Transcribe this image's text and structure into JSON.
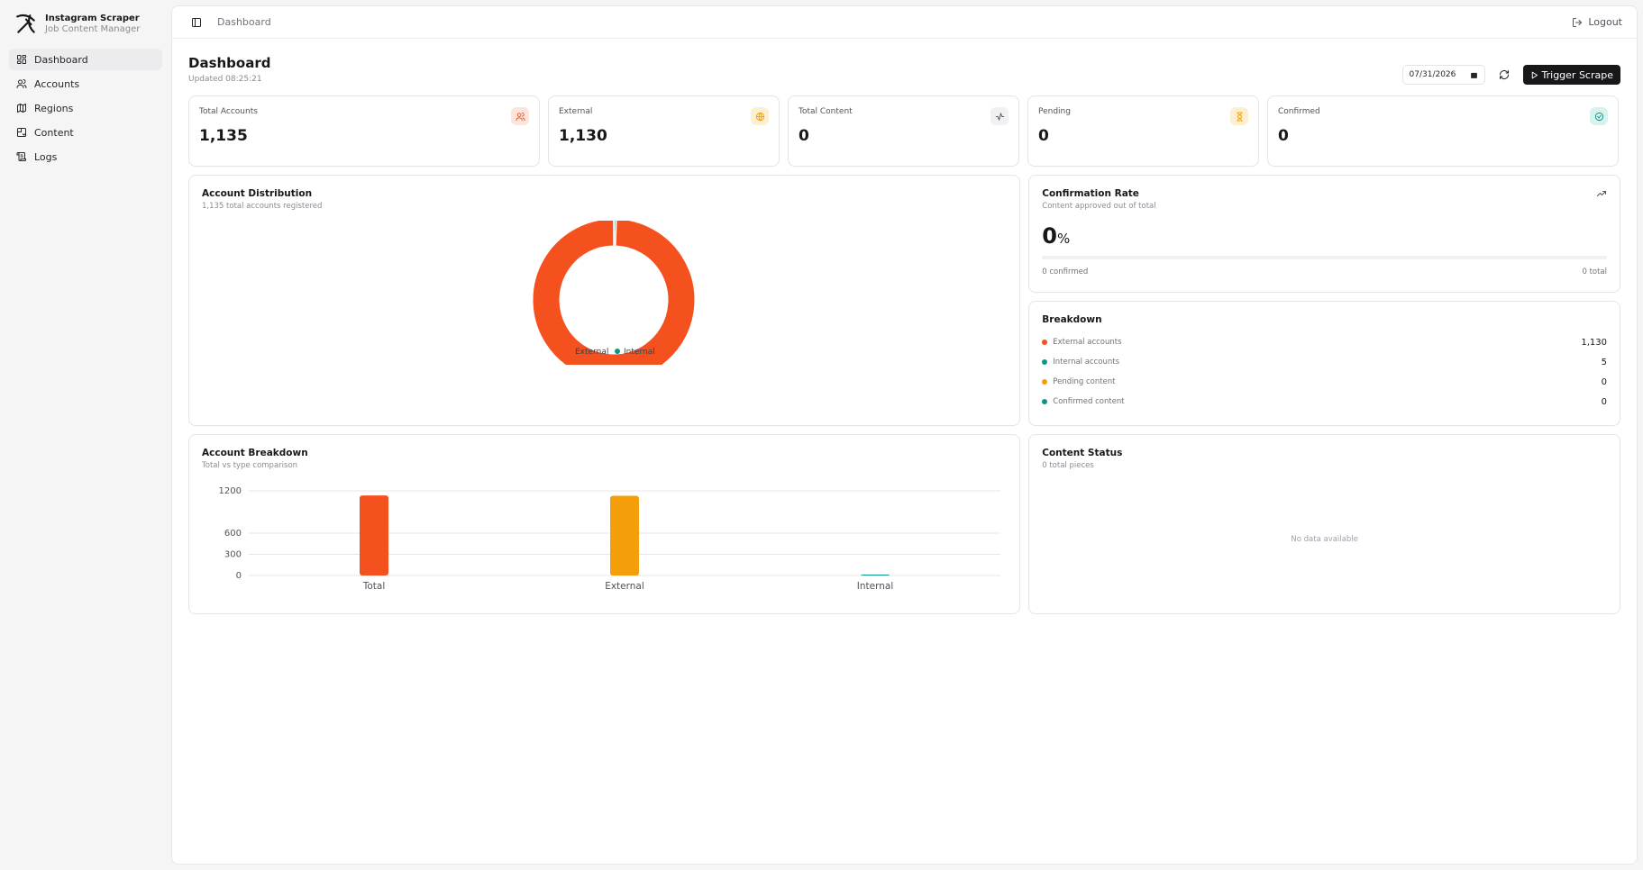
{
  "brand": {
    "title": "Instagram Scraper",
    "subtitle": "Job Content Manager"
  },
  "sidebar": {
    "items": [
      {
        "label": "Dashboard",
        "icon": "grid-icon",
        "active": true
      },
      {
        "label": "Accounts",
        "icon": "users-icon"
      },
      {
        "label": "Regions",
        "icon": "map-icon"
      },
      {
        "label": "Content",
        "icon": "content-icon"
      },
      {
        "label": "Logs",
        "icon": "scroll-icon"
      }
    ]
  },
  "topbar": {
    "breadcrumb": "Dashboard",
    "logout_label": "Logout"
  },
  "header": {
    "title": "Dashboard",
    "updated": "Updated 08:25:21",
    "date_value": "07/31/2026",
    "trigger_label": "Trigger Scrape"
  },
  "stats": [
    {
      "label": "Total Accounts",
      "value": "1,135",
      "icon": "users-icon",
      "badge_bg": "#fde4dc",
      "icon_color": "#f4511e"
    },
    {
      "label": "External",
      "value": "1,130",
      "icon": "globe-icon",
      "badge_bg": "#fdf0d0",
      "icon_color": "#f59e0b"
    },
    {
      "label": "Total Content",
      "value": "0",
      "icon": "activity-icon",
      "badge_bg": "#f1f1f3",
      "icon_color": "#52525b"
    },
    {
      "label": "Pending",
      "value": "0",
      "icon": "hourglass-icon",
      "badge_bg": "#fdf0d0",
      "icon_color": "#f59e0b"
    },
    {
      "label": "Confirmed",
      "value": "0",
      "icon": "check-circle-icon",
      "badge_bg": "#d8f2ee",
      "icon_color": "#0d9488"
    }
  ],
  "distribution": {
    "title": "Account Distribution",
    "subtitle": "1,135 total accounts registered",
    "chart_data": {
      "type": "pie",
      "categories": [
        "External",
        "Internal"
      ],
      "values": [
        1130,
        5
      ],
      "colors": [
        "#f4511e",
        "#0d9488"
      ],
      "legend_placement": "bottom-center"
    }
  },
  "confirmation": {
    "title": "Confirmation Rate",
    "subtitle": "Content approved out of total",
    "value": "0",
    "unit": "%",
    "progress": 0,
    "confirmed_label": "0 confirmed",
    "total_label": "0 total"
  },
  "breakdown": {
    "title": "Breakdown",
    "items": [
      {
        "label": "External accounts",
        "value": "1,130",
        "color": "#f4511e"
      },
      {
        "label": "Internal accounts",
        "value": "5",
        "color": "#0d9488"
      },
      {
        "label": "Pending content",
        "value": "0",
        "color": "#f59e0b"
      },
      {
        "label": "Confirmed content",
        "value": "0",
        "color": "#0d9488"
      }
    ]
  },
  "account_breakdown": {
    "title": "Account Breakdown",
    "subtitle": "Total vs type comparison",
    "chart_data": {
      "type": "bar",
      "categories": [
        "Total",
        "External",
        "Internal"
      ],
      "values": [
        1135,
        1130,
        5
      ],
      "colors": [
        "#f4511e",
        "#f59e0b",
        "#0d9488"
      ],
      "yticks": [
        0,
        300,
        600,
        1200
      ],
      "ylim": [
        0,
        1200
      ],
      "grid": true
    }
  },
  "content_status": {
    "title": "Content Status",
    "subtitle": "0 total pieces",
    "empty_label": "No data available"
  }
}
